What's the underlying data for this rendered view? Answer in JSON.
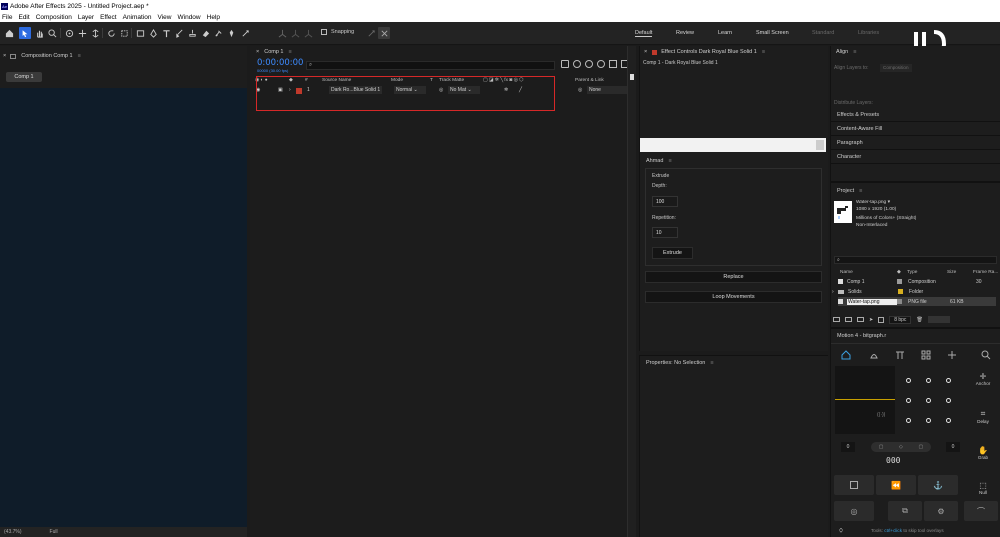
{
  "app": {
    "title": "Adobe After Effects 2025 - Untitled Project.aep *",
    "logo_text": "Ae",
    "accent": "#2d6be0"
  },
  "menu": [
    "File",
    "Edit",
    "Composition",
    "Layer",
    "Effect",
    "Animation",
    "View",
    "Window",
    "Help"
  ],
  "toolbar": {
    "snapping_label": "Snapping",
    "snapping_checked": false
  },
  "workspaces": [
    {
      "label": "Default",
      "active": true
    },
    {
      "label": "Review",
      "active": false
    },
    {
      "label": "Learn",
      "active": false
    },
    {
      "label": "Small Screen",
      "active": false
    },
    {
      "label": "Standard",
      "active": false
    },
    {
      "label": "Libraries",
      "active": false
    }
  ],
  "composition_panel": {
    "title": "Composition Comp 1",
    "tab": "Comp 1"
  },
  "timeline": {
    "tab": "Comp 1",
    "timecode": "0:00:00:00",
    "sub_timecode": "00000 (30.00 fps)",
    "search_placeholder": "",
    "columns": {
      "num": "#",
      "source_name": "Source Name",
      "mode": "Mode",
      "t": "T",
      "track_matte": "Track Matte",
      "parent": "Parent & Link"
    },
    "layers": [
      {
        "num": "1",
        "name": "Dark Ro...Blue Solid 1",
        "mode": "Normal",
        "track_matte": "No Mat",
        "parent": "None",
        "label_color": "#c0392b"
      }
    ],
    "highlight_color": "#d62828"
  },
  "effect_controls": {
    "title": "Effect Controls Dark Royal Blue Solid 1",
    "target": "Comp 1 - Dark Royal Blue Solid 1"
  },
  "ahmad_panel": {
    "title": "Ahmad",
    "section_label": "Extrude",
    "depth_label": "Depth:",
    "depth_value": "100",
    "repetition_label": "Repetition:",
    "repetition_value": "10",
    "extrude_button": "Extrude",
    "replace_button": "Replace",
    "loop_button": "Loop Movements"
  },
  "properties_panel": {
    "title": "Properties: No Selection"
  },
  "right_panels": {
    "align_title": "Align",
    "align_layers_to": "Align Layers to:",
    "align_target": "Composition",
    "distribute_layers": "Distribute Layers:",
    "items": [
      "Effects & Presets",
      "Content-Aware Fill",
      "Paragraph",
      "Character"
    ]
  },
  "project": {
    "title": "Project",
    "preview": {
      "name": "Water-tap.png",
      "dims": "1080 x 1920 (1.00)",
      "colors": "Millions of Colors+ (Straight)",
      "interlace": "Non-Interlaced"
    },
    "columns": {
      "name": "Name",
      "type": "Type",
      "size": "Size",
      "frame_rate": "Frame Ra..."
    },
    "rows": [
      {
        "name": "Comp 1",
        "type": "Composition",
        "size": "",
        "frame_rate": "30",
        "color": "#9a9a9a"
      },
      {
        "name": "Solids",
        "type": "Folder",
        "size": "",
        "frame_rate": "",
        "color": "#d8b020"
      },
      {
        "name": "Water-tap.png",
        "type": "PNG file",
        "size": "61 KB",
        "frame_rate": "",
        "color": "#8a8a8a"
      }
    ],
    "bpc": "8 bpc"
  },
  "motion": {
    "title": "Motion 4 - bitgraph.r",
    "labels": {
      "anchor": "Anchor",
      "delay": "Delay",
      "grab": "Grab",
      "null": "Null"
    },
    "left_value": "0",
    "right_value": "0",
    "center_value": "000",
    "status_prefix": "Tools:",
    "status_highlight": "ctrl+click",
    "status_suffix": "to skip tool overlays",
    "highlight_color": "#3aa0e0"
  },
  "status_bar": {
    "zoom": "(43.7%)",
    "resolution": "Full"
  }
}
